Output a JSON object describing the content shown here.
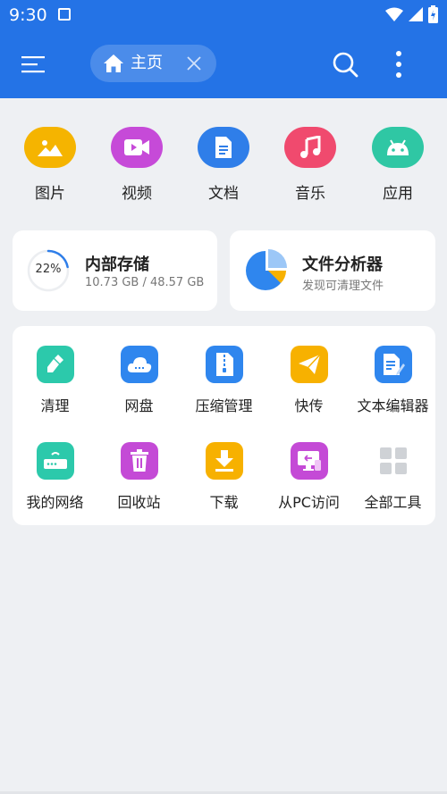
{
  "status": {
    "time": "9:30"
  },
  "tab": {
    "label": "主页"
  },
  "categories": [
    {
      "label": "图片",
      "icon": "image-icon",
      "color": "#f5b400"
    },
    {
      "label": "视频",
      "icon": "video-icon",
      "color": "#c64ad8"
    },
    {
      "label": "文档",
      "icon": "document-icon",
      "color": "#2f7ee9"
    },
    {
      "label": "音乐",
      "icon": "music-icon",
      "color": "#f04a6e"
    },
    {
      "label": "应用",
      "icon": "android-icon",
      "color": "#2fc7a4"
    }
  ],
  "storage": {
    "percent_label": "22%",
    "percent": 22,
    "title": "内部存储",
    "usage": "10.73 GB / 48.57 GB"
  },
  "analyzer": {
    "title": "文件分析器",
    "subtitle": "发现可清理文件"
  },
  "tools": [
    {
      "label": "清理",
      "icon": "broom-icon",
      "color": "#2cc9ab"
    },
    {
      "label": "网盘",
      "icon": "cloud-icon",
      "color": "#2f86ee"
    },
    {
      "label": "压缩管理",
      "icon": "zip-icon",
      "color": "#2f86ee"
    },
    {
      "label": "快传",
      "icon": "send-icon",
      "color": "#f7b100"
    },
    {
      "label": "文本编辑器",
      "icon": "text-editor-icon",
      "color": "#2f86ee"
    },
    {
      "label": "我的网络",
      "icon": "router-icon",
      "color": "#2cc9ab"
    },
    {
      "label": "回收站",
      "icon": "trash-icon",
      "color": "#c44ad6"
    },
    {
      "label": "下载",
      "icon": "download-icon",
      "color": "#f7b100"
    },
    {
      "label": "从PC访问",
      "icon": "pc-access-icon",
      "color": "#c44ad6"
    },
    {
      "label": "全部工具",
      "icon": "grid-icon",
      "color": "#cfd2d6"
    }
  ]
}
